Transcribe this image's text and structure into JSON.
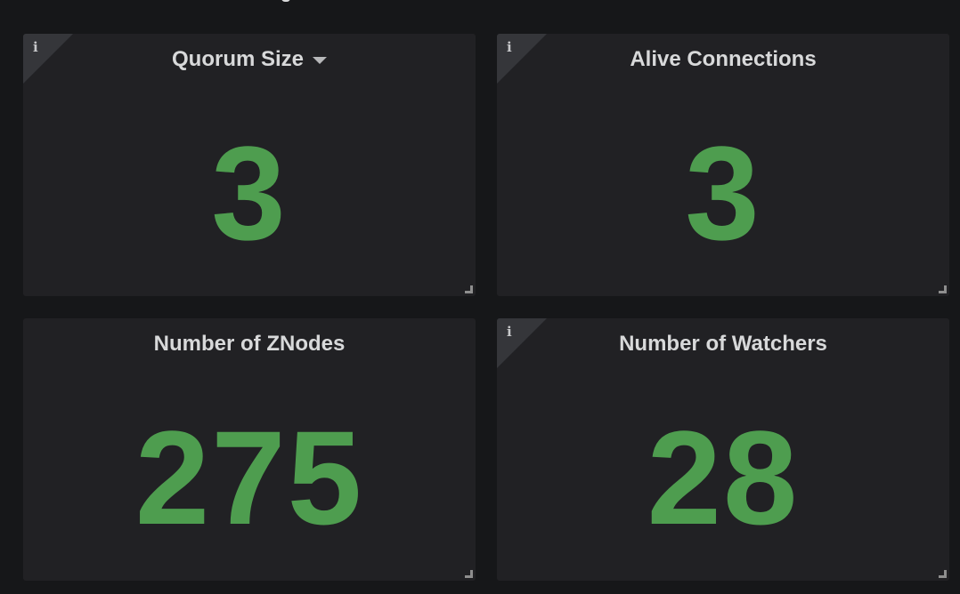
{
  "theme": {
    "background": "#161719",
    "panel_background": "#212124",
    "title_color": "#d8d9da",
    "value_color": "#4e9d4f",
    "corner_color": "#35363a"
  },
  "panels": [
    {
      "title": "Quorum Size",
      "value": "3",
      "has_info_icon": true,
      "info_icon": "info-icon",
      "has_menu_caret": true
    },
    {
      "title": "Alive Connections",
      "value": "3",
      "has_info_icon": true,
      "info_icon": "info-icon",
      "has_menu_caret": false
    },
    {
      "title": "Number of ZNodes",
      "value": "275",
      "has_info_icon": false,
      "has_menu_caret": false
    },
    {
      "title": "Number of Watchers",
      "value": "28",
      "has_info_icon": true,
      "info_icon": "info-icon",
      "has_menu_caret": false
    }
  ],
  "icons": {
    "info_glyph": "i"
  }
}
